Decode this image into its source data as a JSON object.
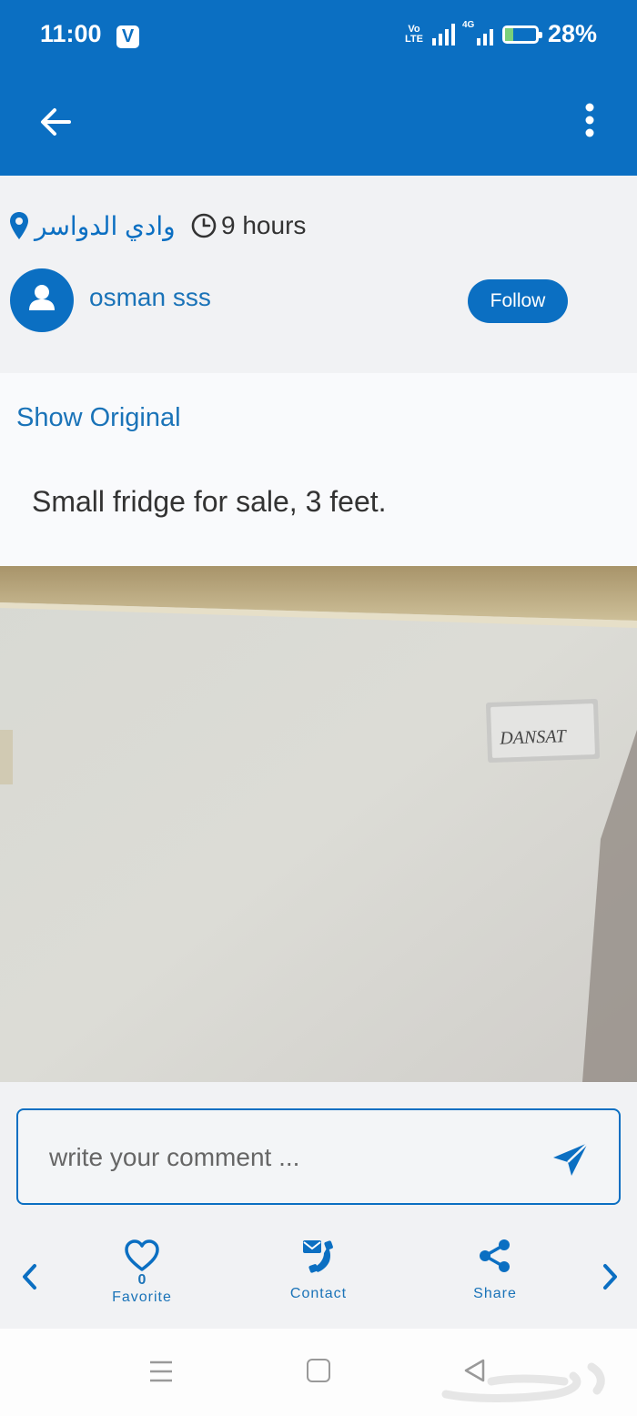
{
  "status_bar": {
    "time": "11:00",
    "notification_icon": "V",
    "volte_line1": "Vo",
    "volte_line2": "LTE",
    "network_type": "4G",
    "battery_percent": "28%",
    "battery_level": 0.28
  },
  "app_bar": {
    "back_icon": "arrow-left-icon",
    "menu_icon": "vertical-dots-icon"
  },
  "post": {
    "location": "وادي الدواسر",
    "time_ago": "9 hours",
    "author": "osman sss",
    "follow_label": "Follow",
    "show_original_label": "Show Original",
    "text": "Small fridge for sale, 3 feet.",
    "photo_brand": "DANSAT"
  },
  "comment": {
    "placeholder": "write your comment ..."
  },
  "actions": {
    "favorite_label": "Favorite",
    "favorite_count": "0",
    "contact_label": "Contact",
    "share_label": "Share"
  },
  "colors": {
    "primary": "#0b6fc2",
    "text_blue": "#1a73b8"
  }
}
